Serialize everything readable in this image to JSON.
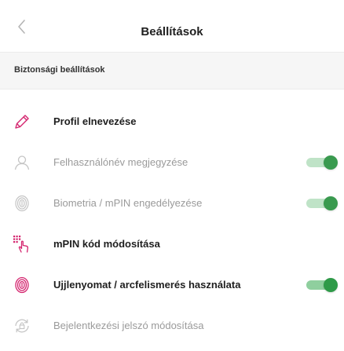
{
  "colors": {
    "accent": "#2e9a48",
    "accent_track": "#8fcf9e",
    "muted_track": "#bfe3c7",
    "muted_knob": "#3a9a4f",
    "pink": "#d4246e",
    "muted_icon": "#c4c4c4"
  },
  "header": {
    "title": "Beállítások",
    "back_icon": "chevron-left-icon"
  },
  "section": {
    "title": "Biztonsági beállítások"
  },
  "items": [
    {
      "label": "Profil elnevezése",
      "icon": "pencil-icon",
      "style": "strong",
      "toggle": null
    },
    {
      "label": "Felhasználónév megjegyzése",
      "icon": "user-icon",
      "style": "muted",
      "toggle": "on"
    },
    {
      "label": "Biometria / mPIN engedélyezése",
      "icon": "fingerprint-icon",
      "style": "muted",
      "toggle": "on"
    },
    {
      "label": "mPIN kód módosítása",
      "icon": "keypad-touch-icon",
      "style": "strong",
      "toggle": null
    },
    {
      "label": "Ujjlenyomat / arcfelismerés használata",
      "icon": "fingerprint-icon",
      "style": "strong",
      "toggle": "on"
    },
    {
      "label": "Bejelentkezési jelszó módosítása",
      "icon": "lock-refresh-icon",
      "style": "muted",
      "toggle": null
    }
  ]
}
